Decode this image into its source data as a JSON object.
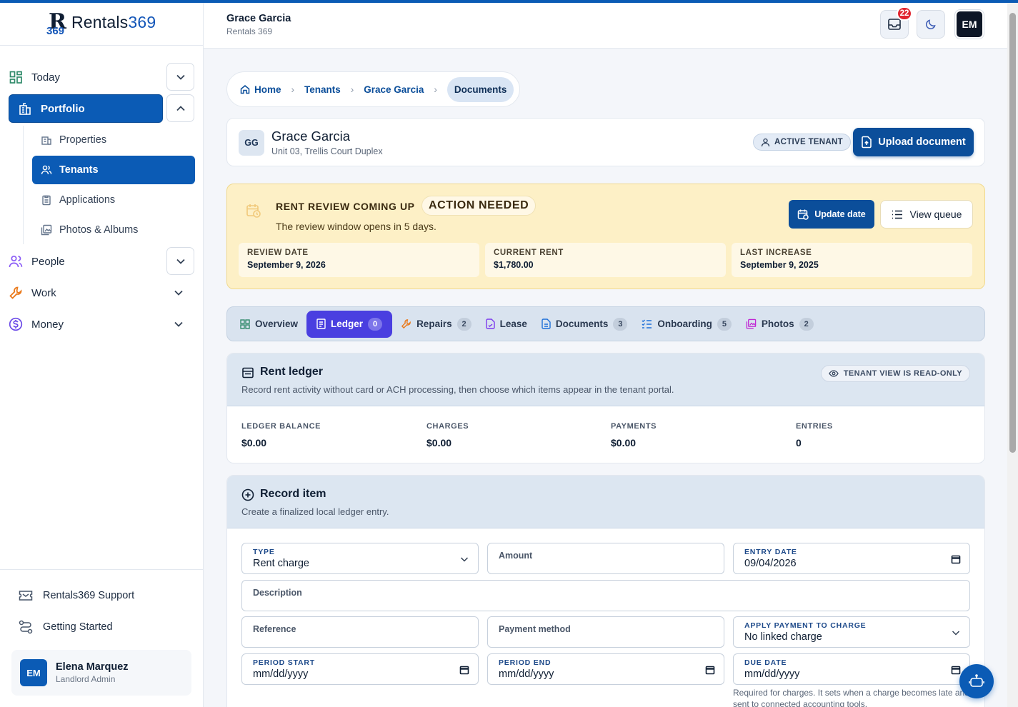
{
  "brand": {
    "name_a": "Rentals",
    "name_b": "369",
    "mark_letter": "R",
    "mark_num": "369"
  },
  "sidebar": {
    "items": [
      {
        "label": "Today",
        "icon": "grid-icon"
      },
      {
        "label": "Portfolio",
        "icon": "building-icon"
      },
      {
        "label": "People",
        "icon": "users-icon"
      },
      {
        "label": "Work",
        "icon": "wrench-icon"
      },
      {
        "label": "Money",
        "icon": "dollar-icon"
      }
    ],
    "portfolio_sub": [
      {
        "label": "Properties",
        "icon": "building-small-icon"
      },
      {
        "label": "Tenants",
        "icon": "users-small-icon"
      },
      {
        "label": "Applications",
        "icon": "clipboard-icon"
      },
      {
        "label": "Photos & Albums",
        "icon": "photos-icon"
      }
    ],
    "bottom": [
      {
        "label": "Rentals369 Support",
        "icon": "ticket-icon"
      },
      {
        "label": "Getting Started",
        "icon": "route-icon"
      }
    ],
    "user": {
      "initials": "EM",
      "name": "Elena Marquez",
      "role": "Landlord Admin"
    }
  },
  "header": {
    "title": "Grace Garcia",
    "subtitle": "Rentals 369",
    "notifications": "22",
    "avatar": "EM"
  },
  "breadcrumb": [
    "Home",
    "Tenants",
    "Grace Garcia",
    "Documents"
  ],
  "tenant": {
    "initials": "GG",
    "name": "Grace Garcia",
    "unit": "Unit 03, Trellis Court Duplex",
    "status": "ACTIVE TENANT",
    "upload_label": "Upload document"
  },
  "alert": {
    "title": "RENT REVIEW COMING UP",
    "pill": "ACTION NEEDED",
    "text": "The review window opens in 5 days.",
    "update_label": "Update date",
    "queue_label": "View queue",
    "stats": [
      {
        "label": "REVIEW DATE",
        "value": "September 9, 2026"
      },
      {
        "label": "CURRENT RENT",
        "value": "$1,780.00"
      },
      {
        "label": "LAST INCREASE",
        "value": "September 9, 2025"
      }
    ]
  },
  "tabs": [
    {
      "label": "Overview",
      "count": null,
      "icon": "grid-icon"
    },
    {
      "label": "Ledger",
      "count": "0",
      "icon": "ledger-icon"
    },
    {
      "label": "Repairs",
      "count": "2",
      "icon": "wrench-icon"
    },
    {
      "label": "Lease",
      "count": null,
      "icon": "file-icon"
    },
    {
      "label": "Documents",
      "count": "3",
      "icon": "document-icon"
    },
    {
      "label": "Onboarding",
      "count": "5",
      "icon": "checklist-icon"
    },
    {
      "label": "Photos",
      "count": "2",
      "icon": "photos-icon"
    }
  ],
  "ledger": {
    "title": "Rent ledger",
    "subtitle": "Record rent activity without card or ACH processing, then choose which items appear in the tenant portal.",
    "readonly": "TENANT VIEW IS READ-ONLY",
    "metrics": [
      {
        "label": "LEDGER BALANCE",
        "value": "$0.00"
      },
      {
        "label": "CHARGES",
        "value": "$0.00"
      },
      {
        "label": "PAYMENTS",
        "value": "$0.00"
      },
      {
        "label": "ENTRIES",
        "value": "0"
      }
    ]
  },
  "record": {
    "title": "Record item",
    "subtitle": "Create a finalized local ledger entry.",
    "type_label": "TYPE",
    "type_value": "Rent charge",
    "amount_ph": "Amount",
    "entry_label": "ENTRY DATE",
    "entry_value": "09/04/2026",
    "description_ph": "Description",
    "reference_ph": "Reference",
    "method_ph": "Payment method",
    "apply_label": "APPLY PAYMENT TO CHARGE",
    "apply_value": "No linked charge",
    "start_label": "PERIOD START",
    "start_value": "mm/dd/yyyy",
    "end_label": "PERIOD END",
    "end_value": "mm/dd/yyyy",
    "due_label": "DUE DATE",
    "due_value": "mm/dd/yyyy",
    "help": "Required for charges. It sets when a charge becomes late and is sent to connected accounting tools."
  }
}
